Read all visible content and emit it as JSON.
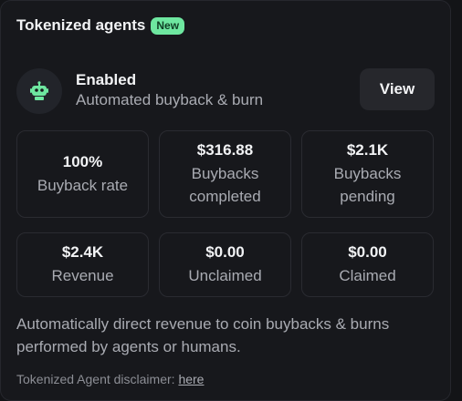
{
  "header": {
    "title": "Tokenized agents",
    "badge": "New"
  },
  "status": {
    "icon": "robot-icon",
    "title": "Enabled",
    "subtitle": "Automated buyback & burn",
    "view_label": "View"
  },
  "stats": [
    {
      "value": "100%",
      "label": "Buyback rate"
    },
    {
      "value": "$316.88",
      "label": "Buybacks completed"
    },
    {
      "value": "$2.1K",
      "label": "Buybacks pending"
    },
    {
      "value": "$2.4K",
      "label": "Revenue"
    },
    {
      "value": "$0.00",
      "label": "Unclaimed"
    },
    {
      "value": "$0.00",
      "label": "Claimed"
    }
  ],
  "description": "Automatically direct revenue to coin buybacks & burns performed by agents or humans.",
  "disclaimer": {
    "text": "Tokenized Agent disclaimer:",
    "link_label": "here"
  },
  "colors": {
    "badge": "#6ee7a0",
    "robot": "#6ee7a0",
    "background": "#17181c"
  }
}
